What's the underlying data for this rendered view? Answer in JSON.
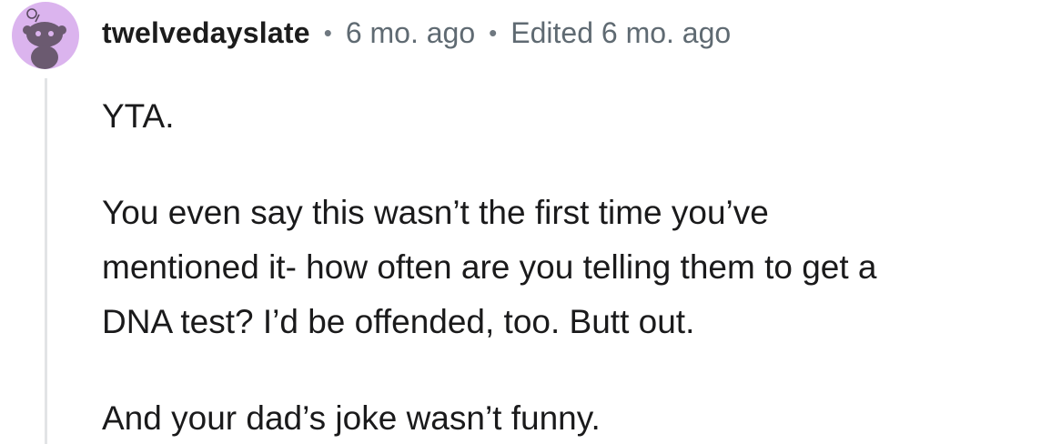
{
  "comment": {
    "author": "twelvedayslate",
    "separator": "•",
    "time": "6 mo. ago",
    "edited": "Edited 6 mo. ago",
    "avatar_icon": "snoo-avatar-icon",
    "avatar_color": "#dbb4ee",
    "paragraphs": [
      {
        "lines": [
          "YTA."
        ]
      },
      {
        "lines": [
          "You even say this wasn’t the first time you’ve",
          "mentioned it- how often are you telling them to get a",
          "DNA test? I’d be offended, too. Butt out."
        ]
      },
      {
        "lines": [
          "And your dad’s joke wasn’t funny."
        ]
      }
    ]
  }
}
